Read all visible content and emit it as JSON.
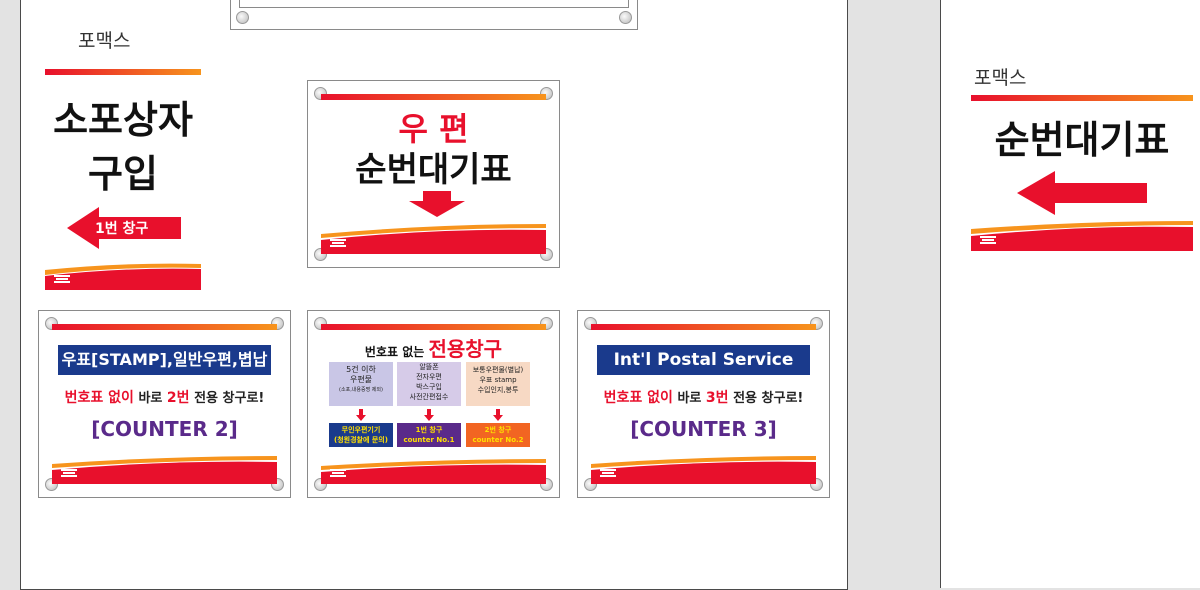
{
  "labels": {
    "pomax_1": "포맥스",
    "pomax_2": "포맥스"
  },
  "sign_parcel": {
    "line1": "소포상자",
    "line2": "구입",
    "arrow_text": "1번 창구"
  },
  "sign_postal": {
    "line1": "우 편",
    "line2": "순번대기표"
  },
  "sign_right": {
    "title": "순번대기표"
  },
  "sign_counter2": {
    "title": "우표[STAMP],일반우편,볍납",
    "sub_a": "번호표 없이",
    "sub_b": " 바로 ",
    "sub_c": "2번",
    "sub_d": " 전용 창구로!",
    "counter": "[COUNTER 2]"
  },
  "sign_dedicated": {
    "heading_a": "번호표 없는 ",
    "heading_b": "전용창구",
    "columns": [
      {
        "body": [
          "5건 이하",
          "우편물",
          "(소포,내용증명 제외)"
        ],
        "result": [
          "무인우편기기",
          "(청원경찰에 문의)"
        ]
      },
      {
        "body": [
          "알뜰폰",
          "전자우편",
          "박스구입",
          "사전간편접수"
        ],
        "result": [
          "1번 창구",
          "counter No.1"
        ]
      },
      {
        "body": [
          "보통우편물(별납)",
          "우표 stamp",
          "수입인지,봉투"
        ],
        "result": [
          "2번 창구",
          "counter No.2"
        ]
      }
    ]
  },
  "sign_counter3": {
    "title": "Int'l Postal Service",
    "sub_a": "번호표 없이",
    "sub_b": " 바로 ",
    "sub_c": "3번",
    "sub_d": " 전용 창구로!",
    "counter": "[COUNTER 3]"
  },
  "colors": {
    "red": "#e8102c",
    "orange": "#f7941d",
    "navy": "#1a3a8c",
    "purple": "#5a2a8a"
  }
}
